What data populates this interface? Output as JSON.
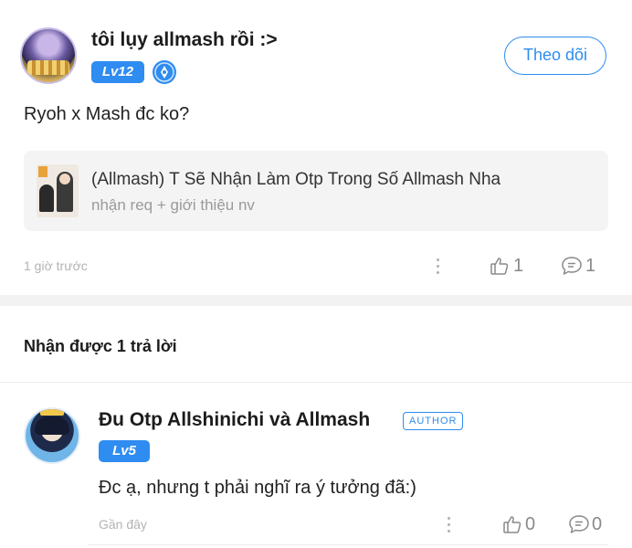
{
  "post": {
    "author_name": "tôi lụy allmash rồi :>",
    "level_badge": "Lv12",
    "follow_label": "Theo dõi",
    "content": "Ryoh x Mash đc ko?",
    "linked_story": {
      "title": "(Allmash) T Sẽ Nhận Làm Otp Trong Số Allmash Nha",
      "subtitle": "nhận req + giới thiệu nv"
    },
    "timestamp": "1 giờ trước",
    "like_count": "1",
    "comment_count": "1"
  },
  "replies_section": {
    "header": "Nhận được 1 trả lời"
  },
  "reply": {
    "author_name": "Đu Otp Allshinichi và Allmash",
    "author_tag": "AUTHOR",
    "level_badge": "Lv5",
    "content": "Đc ạ, nhưng t phải nghĩ ra ý tưởng đã:)",
    "timestamp": "Gần đây",
    "like_count": "0",
    "comment_count": "0"
  },
  "icons": {
    "verified": "creator-shield-icon",
    "like": "thumbs-up-icon",
    "comment": "comment-bubble-icon",
    "more": "more-vertical-icon"
  },
  "colors": {
    "accent": "#2f8cf0",
    "muted_text": "#9a9a9a",
    "card_bg": "#f4f4f5"
  }
}
